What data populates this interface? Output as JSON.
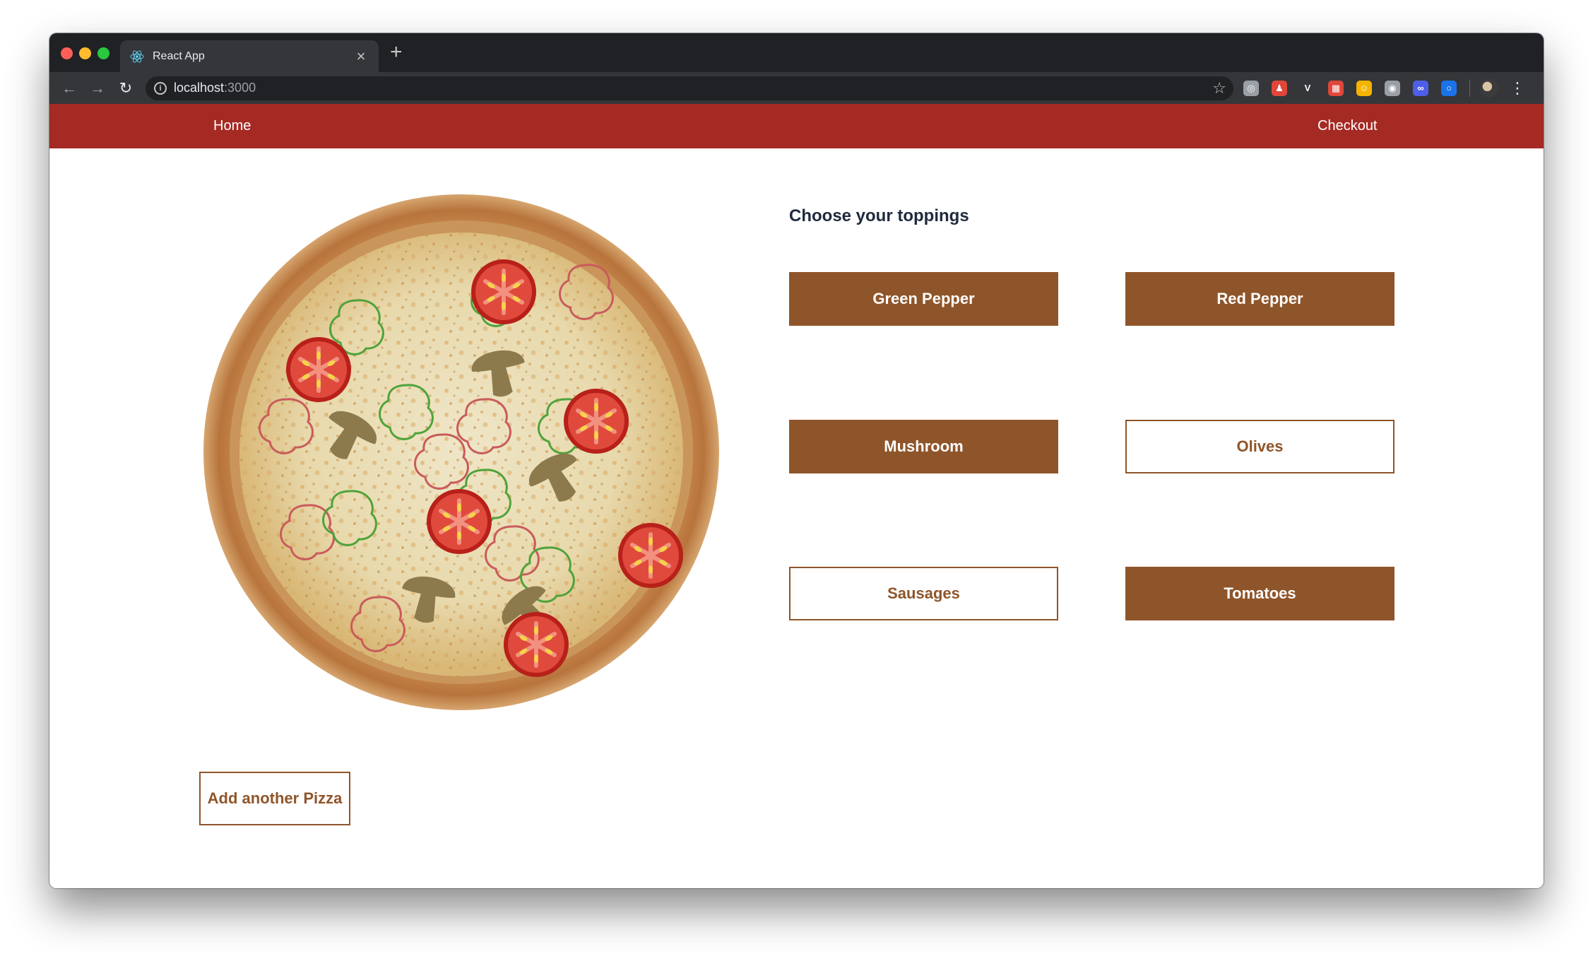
{
  "browser": {
    "tab_title": "React App",
    "tab_close": "×",
    "new_tab": "+",
    "url_host": "localhost",
    "url_port": ":3000",
    "info_glyph": "i",
    "star_glyph": "☆",
    "menu_glyph": "⋮",
    "back_glyph": "←",
    "forward_glyph": "→",
    "reload_glyph": "↻",
    "extensions": [
      {
        "name": "target-extension-icon",
        "color": "#9aa0a6",
        "glyph": "◎"
      },
      {
        "name": "person-extension-icon",
        "color": "#e0473a",
        "glyph": "♟"
      },
      {
        "name": "vue-extension-icon",
        "color": "#35363a",
        "glyph": "V"
      },
      {
        "name": "grid-extension-icon",
        "color": "#e0473a",
        "glyph": "▦"
      },
      {
        "name": "emoji-extension-icon",
        "color": "#f4b400",
        "glyph": "☺"
      },
      {
        "name": "camera-extension-icon",
        "color": "#9aa0a6",
        "glyph": "◉"
      },
      {
        "name": "chat-extension-icon",
        "color": "#4d5ee8",
        "glyph": "∞"
      },
      {
        "name": "ring-extension-icon",
        "color": "#1a73e8",
        "glyph": "○"
      }
    ]
  },
  "navbar": {
    "home": "Home",
    "checkout": "Checkout",
    "color": "#a52a24"
  },
  "toppings": {
    "heading": "Choose your toppings",
    "accent": "#8f552a",
    "items": [
      {
        "label": "Green Pepper",
        "selected": true
      },
      {
        "label": "Red Pepper",
        "selected": true
      },
      {
        "label": "Mushroom",
        "selected": true
      },
      {
        "label": "Olives",
        "selected": false
      },
      {
        "label": "Sausages",
        "selected": false
      },
      {
        "label": "Tomatoes",
        "selected": true
      }
    ]
  },
  "actions": {
    "add_pizza": "Add another Pizza"
  }
}
